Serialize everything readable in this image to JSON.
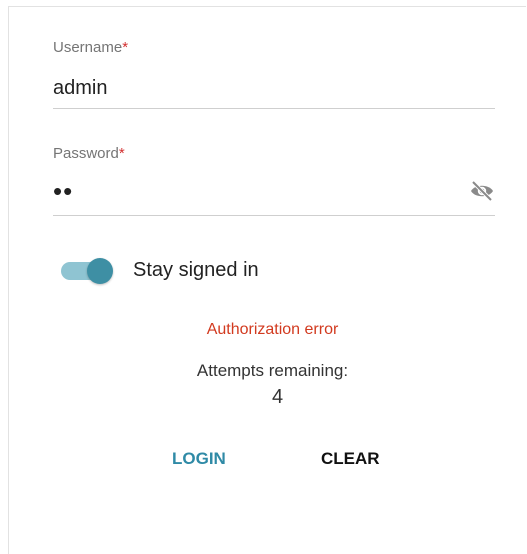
{
  "login_form": {
    "username": {
      "label": "Username",
      "required_mark": "*",
      "value": "admin"
    },
    "password": {
      "label": "Password",
      "required_mark": "*",
      "value": "••",
      "visibility_icon": "eye-off-icon"
    },
    "stay_signed_in": {
      "label": "Stay signed in",
      "checked": true,
      "colors": {
        "track": "#8fc4d2",
        "knob": "#3e8fa4"
      }
    },
    "error_message": "Authorization error",
    "attempts": {
      "label": "Attempts remaining:",
      "value": "4"
    },
    "buttons": {
      "login": "LOGIN",
      "clear": "CLEAR"
    },
    "colors": {
      "accent": "#2f8aa6",
      "error": "#d23a1f",
      "required": "#d32f2f"
    }
  }
}
